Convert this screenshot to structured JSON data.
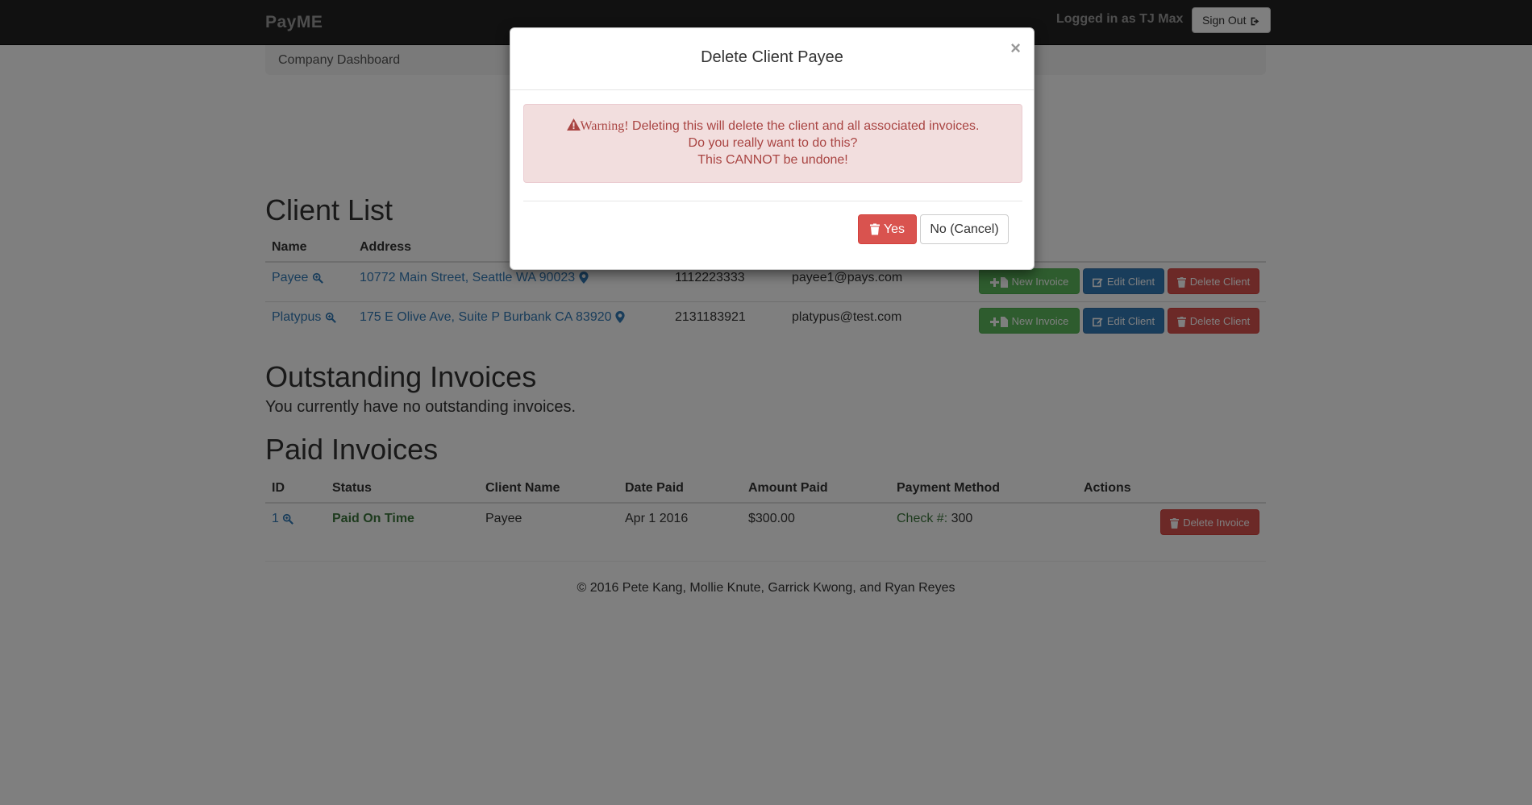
{
  "navbar": {
    "brand": "PayME",
    "logged_in": "Logged in as TJ Max",
    "signout_label": "Sign Out"
  },
  "breadcrumb": {
    "label": "Company Dashboard"
  },
  "client_list": {
    "title": "Client List",
    "headers": {
      "name": "Name",
      "address": "Address"
    },
    "rows": [
      {
        "name": "Payee",
        "address": "10772 Main Street, Seattle WA 90023",
        "phone": "1112223333",
        "email": "payee1@pays.com"
      },
      {
        "name": "Platypus",
        "address": "175 E Olive Ave, Suite P Burbank CA 83920",
        "phone": "2131183921",
        "email": "platypus@test.com"
      }
    ],
    "buttons": {
      "new_invoice": "New Invoice",
      "edit_client": "Edit Client",
      "delete_client": "Delete Client"
    }
  },
  "outstanding": {
    "title": "Outstanding Invoices",
    "message": "You currently have no outstanding invoices."
  },
  "paid": {
    "title": "Paid Invoices",
    "headers": {
      "id": "ID",
      "status": "Status",
      "client": "Client Name",
      "date": "Date Paid",
      "amount": "Amount Paid",
      "method": "Payment Method",
      "actions": "Actions"
    },
    "rows": [
      {
        "id": "1",
        "status": "Paid On Time",
        "client": "Payee",
        "date": "Apr 1 2016",
        "amount": "$300.00",
        "method_label": "Check #:",
        "method_value": "300"
      }
    ],
    "delete_invoice": "Delete Invoice"
  },
  "footer": {
    "text": "© 2016 Pete Kang, Mollie Knute, Garrick Kwong, and Ryan Reyes"
  },
  "modal": {
    "title": "Delete Client Payee",
    "close": "×",
    "warning_word": "Warning!",
    "warning_line1": " Deleting this will delete the client and all associated invoices.",
    "warning_line2": "Do you really want to do this?",
    "warning_line3": "This CANNOT be undone!",
    "yes_label": "Yes",
    "no_label": "No (Cancel)"
  },
  "colors": {
    "success": "#5cb85c",
    "primary": "#337ab7",
    "danger": "#d9534f",
    "navbar": "#222222",
    "alert_text": "#a94442"
  }
}
